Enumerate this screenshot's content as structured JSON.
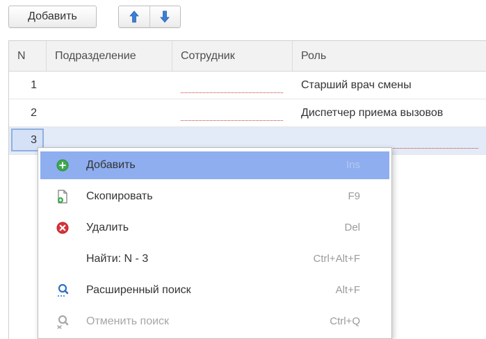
{
  "toolbar": {
    "add_label": "Добавить",
    "move_up_icon": "arrow-up-icon",
    "move_down_icon": "arrow-down-icon",
    "accent": "#3a7fd5"
  },
  "table": {
    "columns": [
      "N",
      "Подразделение",
      "Сотрудник",
      "Роль"
    ],
    "rows": [
      {
        "n": "1",
        "department": "",
        "employee": "",
        "role": "Старший врач смены"
      },
      {
        "n": "2",
        "department": "",
        "employee": "",
        "role": "Диспетчер приема вызовов"
      },
      {
        "n": "3",
        "department": "",
        "employee": "",
        "role": ""
      }
    ],
    "selected_row": 3
  },
  "context_menu": {
    "items": [
      {
        "label": "Добавить",
        "shortcut": "Ins",
        "icon": "add-circle-icon",
        "selected": true
      },
      {
        "label": "Скопировать",
        "shortcut": "F9",
        "icon": "copy-document-icon"
      },
      {
        "label": "Удалить",
        "shortcut": "Del",
        "icon": "delete-circle-icon"
      },
      {
        "label": "Найти: N - 3",
        "shortcut": "Ctrl+Alt+F",
        "icon": ""
      },
      {
        "label": "Расширенный поиск",
        "shortcut": "Alt+F",
        "icon": "advanced-search-icon"
      },
      {
        "label": "Отменить поиск",
        "shortcut": "Ctrl+Q",
        "icon": "cancel-search-icon",
        "disabled": true
      }
    ],
    "highlight_color": "#8eaef0"
  }
}
